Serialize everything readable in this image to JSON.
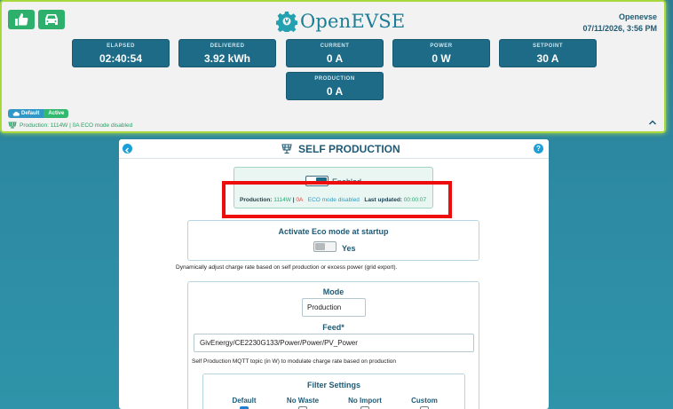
{
  "header": {
    "brand": "OpenEVSE",
    "device_name": "Openevse",
    "datetime": "07/11/2026, 3:56 PM",
    "cards": [
      {
        "label": "ELAPSED",
        "value": "02:40:54"
      },
      {
        "label": "DELIVERED",
        "value": "3.92 kWh"
      },
      {
        "label": "CURRENT",
        "value": "0 A"
      },
      {
        "label": "POWER",
        "value": "0 W"
      },
      {
        "label": "SETPOINT",
        "value": "30 A"
      },
      {
        "label": "PRODUCTION",
        "value": "0 A"
      }
    ],
    "badge_default": "Default",
    "badge_active": "Active",
    "production_line": "Production: 1114W | 0A  ECO mode disabled",
    "colors": {
      "accent": "#1e6b87",
      "green": "#2db06b",
      "border": "#a8d83c"
    }
  },
  "panel": {
    "title": "SELF PRODUCTION",
    "enabled_label": "Enabled",
    "status": {
      "production_label": "Production:",
      "production_value": "1114W",
      "separator": "|",
      "amps": "0A",
      "eco": "ECO mode disabled",
      "updated_label": "Last updated:",
      "updated_value": "00:00:07"
    },
    "eco_title": "Activate Eco mode at startup",
    "eco_value": "Yes",
    "desc_dynamic": "Dynamically adjust charge rate based on self production or excess power (grid export).",
    "mode_title": "Mode",
    "mode_value": "Production",
    "feed_title": "Feed*",
    "feed_value": "GivEnergy/CE2230G133/Power/Power/PV_Power",
    "feed_desc": "Self Production MQTT topic (in W) to modulate charge rate based on production",
    "filter_title": "Filter Settings",
    "filters": [
      {
        "label": "Default",
        "checked": true
      },
      {
        "label": "No Waste",
        "checked": false
      },
      {
        "label": "No Import",
        "checked": false
      },
      {
        "label": "Custom",
        "checked": false
      }
    ]
  }
}
